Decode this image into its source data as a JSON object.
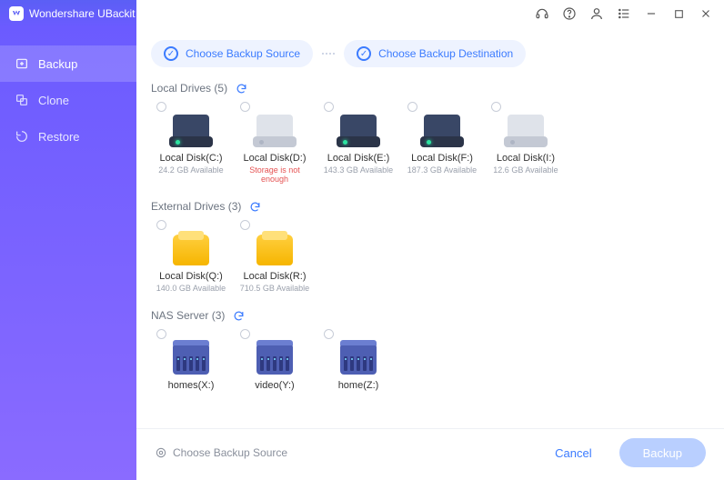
{
  "app_title": "Wondershare UBackit",
  "sidebar": {
    "items": [
      {
        "label": "Backup",
        "icon": "backup-icon",
        "active": true
      },
      {
        "label": "Clone",
        "icon": "clone-icon",
        "active": false
      },
      {
        "label": "Restore",
        "icon": "restore-icon",
        "active": false
      }
    ]
  },
  "steps": {
    "source_label": "Choose Backup Source",
    "destination_label": "Choose Backup Destination"
  },
  "sections": {
    "local": {
      "title": "Local Drives",
      "count": 5
    },
    "external": {
      "title": "External Drives",
      "count": 3
    },
    "nas": {
      "title": "NAS Server",
      "count": 3
    }
  },
  "local_drives": [
    {
      "name": "Local Disk(C:)",
      "sub": "24.2 GB Available",
      "err": false,
      "style": "dark"
    },
    {
      "name": "Local Disk(D:)",
      "sub": "Storage is not enough",
      "err": true,
      "style": "light"
    },
    {
      "name": "Local Disk(E:)",
      "sub": "143.3 GB Available",
      "err": false,
      "style": "dark"
    },
    {
      "name": "Local Disk(F:)",
      "sub": "187.3 GB Available",
      "err": false,
      "style": "dark"
    },
    {
      "name": "Local Disk(I:)",
      "sub": "12.6 GB Available",
      "err": false,
      "style": "light"
    }
  ],
  "external_drives": [
    {
      "name": "Local Disk(Q:)",
      "sub": "140.0 GB Available"
    },
    {
      "name": "Local Disk(R:)",
      "sub": "710.5 GB Available"
    }
  ],
  "nas_servers": [
    {
      "name": "homes(X:)"
    },
    {
      "name": "video(Y:)"
    },
    {
      "name": "home(Z:)"
    }
  ],
  "footer": {
    "hint": "Choose Backup Source",
    "cancel_label": "Cancel",
    "backup_label": "Backup"
  }
}
